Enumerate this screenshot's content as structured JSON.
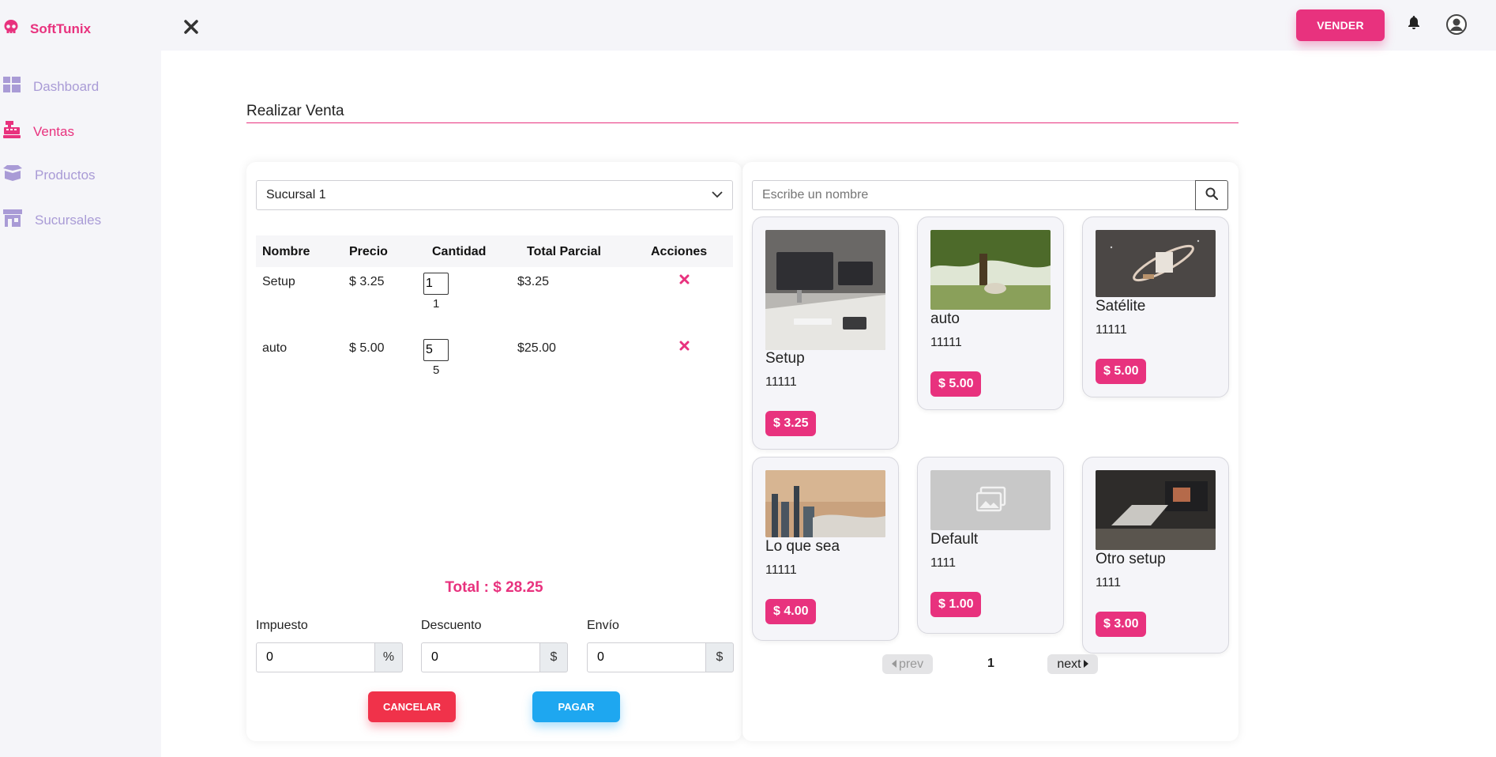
{
  "brand": {
    "name": "SoftTunix",
    "color": "#e8327e"
  },
  "sidebar": {
    "items": [
      {
        "label": "Dashboard",
        "icon": "dashboard-icon",
        "active": false
      },
      {
        "label": "Ventas",
        "icon": "cash-register-icon",
        "active": true
      },
      {
        "label": "Productos",
        "icon": "box-icon",
        "active": false
      },
      {
        "label": "Sucursales",
        "icon": "store-icon",
        "active": false
      }
    ]
  },
  "topbar": {
    "vender_label": "VENDER",
    "close_icon": "close-icon",
    "bell_icon": "bell-icon",
    "user_icon": "user-icon"
  },
  "page": {
    "title": "Realizar Venta"
  },
  "sale": {
    "branch": "Sucursal 1",
    "columns": [
      "Nombre",
      "Precio",
      "Cantidad",
      "Total Parcial",
      "Acciones"
    ],
    "rows": [
      {
        "name": "Setup",
        "price": "$ 3.25",
        "qty": "1",
        "qty_text": "1",
        "subtotal": "$3.25"
      },
      {
        "name": "auto",
        "price": "$ 5.00",
        "qty": "5",
        "qty_text": "5",
        "subtotal": "$25.00"
      }
    ],
    "total": "Total : $ 28.25",
    "fields": [
      {
        "label": "Impuesto",
        "value": "0",
        "addon": "%"
      },
      {
        "label": "Descuento",
        "value": "0",
        "addon": "$"
      },
      {
        "label": "Envío",
        "value": "0",
        "addon": "$"
      }
    ],
    "cancel_label": "CANCELAR",
    "pay_label": "PAGAR"
  },
  "catalog": {
    "search_placeholder": "Escribe un nombre",
    "products": [
      {
        "name": "Setup",
        "code": "11111",
        "price": "$ 3.25"
      },
      {
        "name": "auto",
        "code": "11111",
        "price": "$ 5.00"
      },
      {
        "name": "Satélite",
        "code": "11111",
        "price": "$ 5.00"
      },
      {
        "name": "Lo que sea",
        "code": "11111",
        "price": "$ 4.00"
      },
      {
        "name": "Default",
        "code": "1111",
        "price": "$ 1.00"
      },
      {
        "name": "Otro setup",
        "code": "1111",
        "price": "$ 3.00"
      }
    ],
    "pagination": {
      "prev": "prev",
      "page": "1",
      "next": "next"
    }
  }
}
